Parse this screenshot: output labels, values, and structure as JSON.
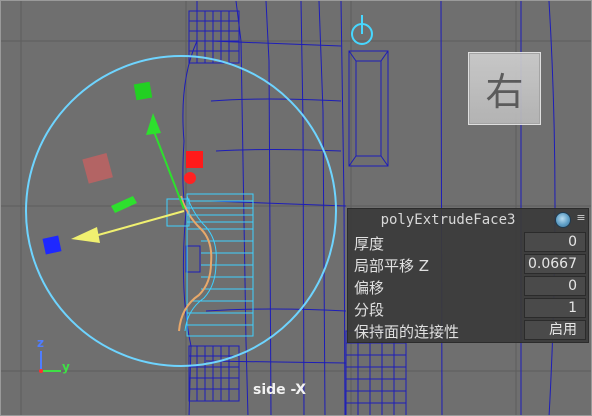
{
  "viewport": {
    "view_label": "side -X",
    "axis_labels": {
      "z": "z",
      "y": "y"
    }
  },
  "view_cube": {
    "face_label": "右"
  },
  "attribute_panel": {
    "node_name": "polyExtrudeFace3",
    "icon": "node-sphere-icon",
    "menu_icon": "menu-lines-icon",
    "attributes": [
      {
        "label": "厚度",
        "value": "0"
      },
      {
        "label": "局部平移 Z",
        "value": "0.0667"
      },
      {
        "label": "偏移",
        "value": "0"
      },
      {
        "label": "分段",
        "value": "1"
      },
      {
        "label": "保持面的连接性",
        "value": "启用"
      }
    ]
  },
  "colors": {
    "viewport_bg": "#6f6f6f",
    "wireframe": "#1a1ab4",
    "selection": "#43d4ff",
    "handle_x": "#ff2020",
    "handle_y": "#20e020",
    "handle_z": "#2030ff",
    "rotate_ring": "#7ad8ff",
    "panel_bg": "#3a3a3a"
  }
}
